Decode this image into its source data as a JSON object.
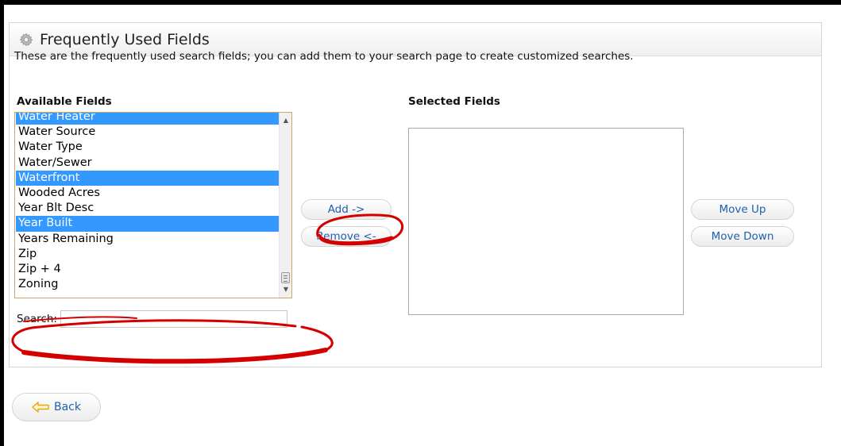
{
  "panel": {
    "title": "Frequently Used Fields",
    "description": "These are the frequently used search fields; you can add them to your search page to create customized searches."
  },
  "available": {
    "label": "Available Fields",
    "items": [
      {
        "label": "Water Heater",
        "selected": true
      },
      {
        "label": "Water Source",
        "selected": false
      },
      {
        "label": "Water Type",
        "selected": false
      },
      {
        "label": "Water/Sewer",
        "selected": false
      },
      {
        "label": "Waterfront",
        "selected": true
      },
      {
        "label": "Wooded Acres",
        "selected": false
      },
      {
        "label": "Year Blt Desc",
        "selected": false
      },
      {
        "label": "Year Built",
        "selected": true
      },
      {
        "label": "Years Remaining",
        "selected": false
      },
      {
        "label": "Zip",
        "selected": false
      },
      {
        "label": "Zip + 4",
        "selected": false
      },
      {
        "label": "Zoning",
        "selected": false
      }
    ]
  },
  "selected_fields": {
    "label": "Selected Fields"
  },
  "search": {
    "label": "Search:",
    "value": ""
  },
  "buttons": {
    "add": "Add ->",
    "remove": "Remove <-",
    "move_up": "Move Up",
    "move_down": "Move Down",
    "back": "Back"
  },
  "icons": {
    "header": "gear-icon",
    "back": "left-arrow-icon"
  },
  "colors": {
    "selection": "#3399ff",
    "link_text": "#1f5fae",
    "annotation": "#d40000",
    "back_arrow": "#f0b400"
  }
}
